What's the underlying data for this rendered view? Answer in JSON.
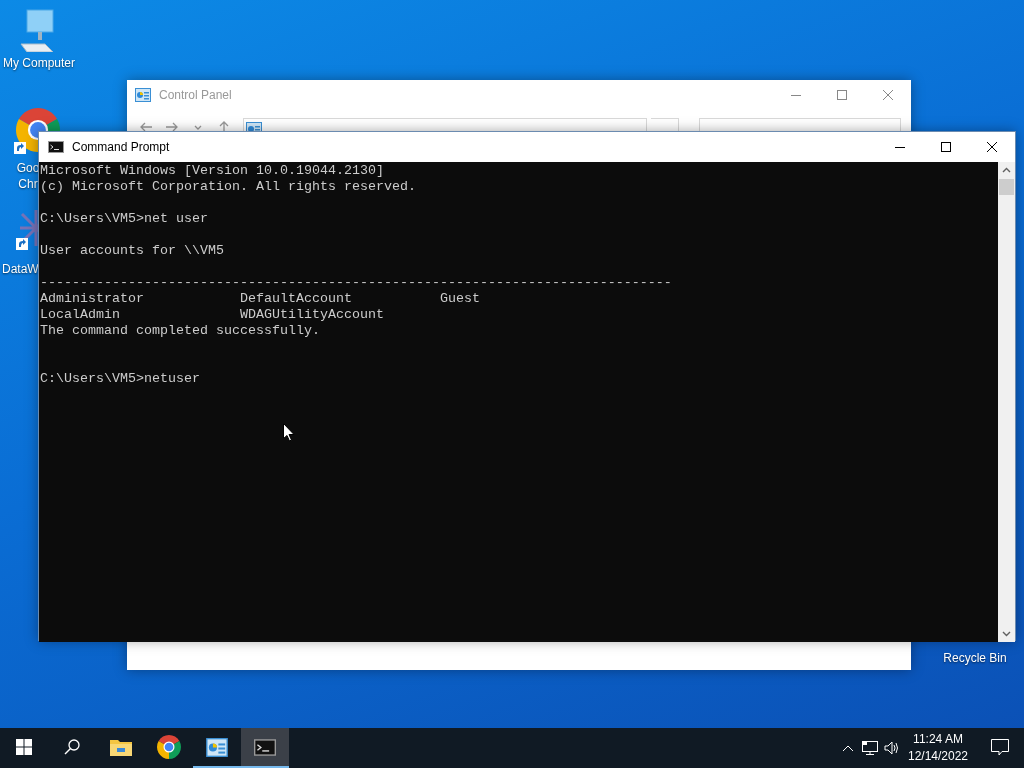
{
  "desktop_icons": [
    {
      "kind": "computer",
      "label": "My Computer"
    },
    {
      "kind": "chrome",
      "label": "Goo Chr"
    },
    {
      "kind": "shortcut",
      "label": "DataW"
    },
    {
      "kind": "recycle",
      "label": "Recycle Bin"
    }
  ],
  "control_panel": {
    "title": "Control Panel",
    "active": false
  },
  "command_prompt": {
    "title": "Command Prompt",
    "active": true,
    "blocks": [
      {
        "lines": [
          "Microsoft Windows [Version 10.0.19044.2130]",
          "(c) Microsoft Corporation. All rights reserved."
        ]
      },
      {
        "lines": [
          "C:\\Users\\VM5>net user"
        ]
      },
      {
        "lines": [
          "User accounts for \\\\VM5"
        ]
      },
      {
        "lines": [
          "-------------------------------------------------------------------------------",
          "Administrator            DefaultAccount           Guest",
          "LocalAdmin               WDAGUtilityAccount",
          "The command completed successfully."
        ]
      }
    ],
    "prompt": "C:\\Users\\VM5>netuser"
  },
  "taskbar": {
    "apps": [
      {
        "kind": "folder",
        "running": false,
        "selected": false
      },
      {
        "kind": "chrome",
        "running": false,
        "selected": false
      },
      {
        "kind": "control-panel",
        "running": true,
        "selected": false
      },
      {
        "kind": "terminal",
        "running": true,
        "selected": true
      }
    ],
    "clock": {
      "time": "11:24 AM",
      "date": "12/14/2022"
    }
  }
}
